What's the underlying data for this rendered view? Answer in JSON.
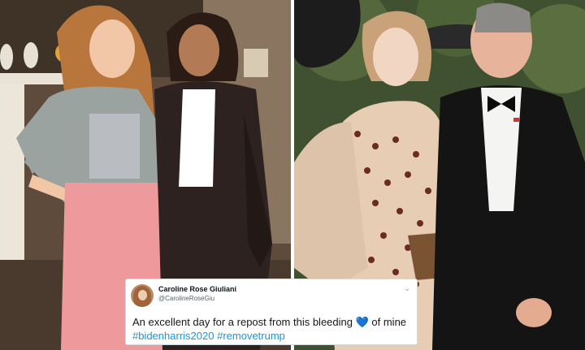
{
  "tweet": {
    "display_name": "Caroline Rose Giuliani",
    "handle": "@CarolineRoseGiu",
    "text_before": "An excellent day for a repost from this bleeding ",
    "heart": "💙",
    "text_after": " of mine ",
    "hashtag_1": "#bidenharris2020",
    "hashtag_2": "#removetrump"
  },
  "icons": {
    "menu": "chevron-down-icon"
  },
  "colors": {
    "hashtag": "#1b95e0",
    "heart": "#1da1f2"
  }
}
